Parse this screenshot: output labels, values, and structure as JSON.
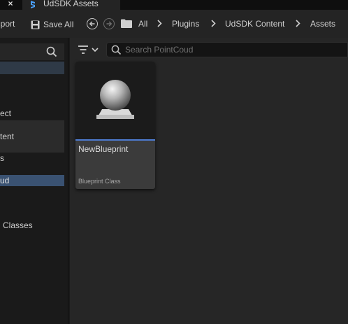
{
  "tab": {
    "title": "UdSDK Assets",
    "close_label": "×"
  },
  "toolbar": {
    "import_label": "nport",
    "save_all_label": "Save All",
    "breadcrumbs": [
      "All",
      "Plugins",
      "UdSDK Content",
      "Assets"
    ]
  },
  "sidebar": {
    "items": [
      {
        "label": "ect"
      },
      {
        "label": "tent"
      },
      {
        "label": "s"
      },
      {
        "label": "ud"
      },
      {
        "label": "Classes"
      }
    ]
  },
  "content": {
    "search": {
      "placeholder": "Search PointCoud",
      "value": ""
    },
    "assets": [
      {
        "name": "NewBlueprint",
        "type": "Blueprint Class"
      }
    ]
  },
  "colors": {
    "accent": "#4d7bd1",
    "selection": "#3a5272",
    "background": "#1a1a1a",
    "panel": "#262626"
  }
}
